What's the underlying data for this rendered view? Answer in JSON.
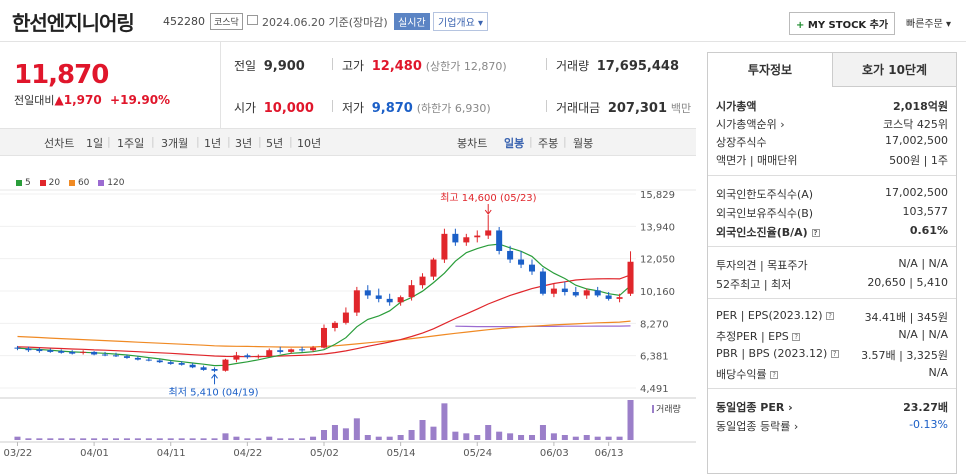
{
  "header": {
    "stock_name": "한선엔지니어링",
    "code": "452280",
    "market": "코스닥",
    "date_text": "2024.06.20 기준(장마감)",
    "realtime_badge": "실시간",
    "corp_overview": "기업개요 ▾",
    "mystock_plus": "+",
    "mystock_label": "MY STOCK 추가",
    "fast_order": "빠른주문 ▾"
  },
  "price": {
    "current": "11,870",
    "change_label": "전일대비",
    "change_arrow": "▲",
    "change_amount": "1,970",
    "change_pct": "+19.90%",
    "prev_close_label": "전일",
    "prev_close": "9,900",
    "high_label": "고가",
    "high": "12,480",
    "upper_limit": "(상한가 12,870)",
    "volume_label": "거래량",
    "volume": "17,695,448",
    "open_label": "시가",
    "open": "10,000",
    "low_label": "저가",
    "low": "9,870",
    "lower_limit": "(하한가 6,930)",
    "value_label": "거래대금",
    "value": "207,301",
    "value_unit": "백만"
  },
  "tabs": {
    "line_chart": "선차트",
    "line_items": [
      "1일",
      "1주일",
      "3개월",
      "1년",
      "3년",
      "5년",
      "10년"
    ],
    "candle_chart": "봉차트",
    "candle_items": [
      "일봉",
      "주봉",
      "월봉"
    ],
    "active_candle": "일봉"
  },
  "chart_data": {
    "type": "candlestick",
    "legend": [
      {
        "name": "5",
        "color": "#2a9d3a"
      },
      {
        "name": "20",
        "color": "#e0262b"
      },
      {
        "name": "60",
        "color": "#f08a24"
      },
      {
        "name": "120",
        "color": "#9b6bd1"
      }
    ],
    "y_ticks": [
      "15,829",
      "13,940",
      "12,050",
      "10,160",
      "8,270",
      "6,381",
      "4,491"
    ],
    "y_range": [
      4491,
      15829
    ],
    "x_ticks": [
      "03/22",
      "04/01",
      "04/11",
      "04/22",
      "05/02",
      "05/14",
      "05/24",
      "06/03",
      "06/13"
    ],
    "max_annotation": "최고 14,600 (05/23)",
    "min_annotation": "최저 5,410 (04/19)",
    "volume_label": "거래량",
    "candles": [
      {
        "o": 6850,
        "h": 6950,
        "l": 6700,
        "c": 6800
      },
      {
        "o": 6800,
        "h": 6900,
        "l": 6600,
        "c": 6700
      },
      {
        "o": 6750,
        "h": 6850,
        "l": 6550,
        "c": 6650
      },
      {
        "o": 6700,
        "h": 6800,
        "l": 6550,
        "c": 6600
      },
      {
        "o": 6650,
        "h": 6750,
        "l": 6500,
        "c": 6550
      },
      {
        "o": 6600,
        "h": 6700,
        "l": 6450,
        "c": 6500
      },
      {
        "o": 6550,
        "h": 6700,
        "l": 6450,
        "c": 6600
      },
      {
        "o": 6600,
        "h": 6650,
        "l": 6400,
        "c": 6450
      },
      {
        "o": 6450,
        "h": 6600,
        "l": 6350,
        "c": 6400
      },
      {
        "o": 6400,
        "h": 6550,
        "l": 6300,
        "c": 6350
      },
      {
        "o": 6350,
        "h": 6450,
        "l": 6200,
        "c": 6250
      },
      {
        "o": 6250,
        "h": 6350,
        "l": 6100,
        "c": 6150
      },
      {
        "o": 6150,
        "h": 6250,
        "l": 6050,
        "c": 6100
      },
      {
        "o": 6100,
        "h": 6200,
        "l": 5950,
        "c": 6000
      },
      {
        "o": 6000,
        "h": 6100,
        "l": 5850,
        "c": 5900
      },
      {
        "o": 5950,
        "h": 6050,
        "l": 5800,
        "c": 5850
      },
      {
        "o": 5850,
        "h": 5950,
        "l": 5650,
        "c": 5700
      },
      {
        "o": 5700,
        "h": 5800,
        "l": 5500,
        "c": 5550
      },
      {
        "o": 5600,
        "h": 5700,
        "l": 5410,
        "c": 5500
      },
      {
        "o": 5500,
        "h": 6200,
        "l": 5450,
        "c": 6150
      },
      {
        "o": 6150,
        "h": 6600,
        "l": 6000,
        "c": 6400
      },
      {
        "o": 6400,
        "h": 6500,
        "l": 6200,
        "c": 6300
      },
      {
        "o": 6300,
        "h": 6450,
        "l": 6200,
        "c": 6350
      },
      {
        "o": 6350,
        "h": 6800,
        "l": 6300,
        "c": 6700
      },
      {
        "o": 6700,
        "h": 6900,
        "l": 6500,
        "c": 6600
      },
      {
        "o": 6600,
        "h": 6800,
        "l": 6500,
        "c": 6750
      },
      {
        "o": 6750,
        "h": 6900,
        "l": 6600,
        "c": 6700
      },
      {
        "o": 6700,
        "h": 6950,
        "l": 6600,
        "c": 6850
      },
      {
        "o": 6850,
        "h": 8200,
        "l": 6800,
        "c": 8000
      },
      {
        "o": 8000,
        "h": 8400,
        "l": 7800,
        "c": 8300
      },
      {
        "o": 8300,
        "h": 9200,
        "l": 8200,
        "c": 8900
      },
      {
        "o": 8900,
        "h": 10400,
        "l": 8700,
        "c": 10200
      },
      {
        "o": 10200,
        "h": 10500,
        "l": 9700,
        "c": 9900
      },
      {
        "o": 9900,
        "h": 10300,
        "l": 9500,
        "c": 9700
      },
      {
        "o": 9700,
        "h": 10000,
        "l": 9300,
        "c": 9500
      },
      {
        "o": 9500,
        "h": 9900,
        "l": 9300,
        "c": 9800
      },
      {
        "o": 9800,
        "h": 10800,
        "l": 9600,
        "c": 10500
      },
      {
        "o": 10500,
        "h": 11200,
        "l": 10300,
        "c": 11000
      },
      {
        "o": 11000,
        "h": 12100,
        "l": 10800,
        "c": 12000
      },
      {
        "o": 12000,
        "h": 13800,
        "l": 11800,
        "c": 13500
      },
      {
        "o": 13500,
        "h": 13800,
        "l": 12800,
        "c": 13000
      },
      {
        "o": 13000,
        "h": 13500,
        "l": 12800,
        "c": 13300
      },
      {
        "o": 13300,
        "h": 13700,
        "l": 13000,
        "c": 13400
      },
      {
        "o": 13400,
        "h": 14600,
        "l": 13200,
        "c": 13700
      },
      {
        "o": 13700,
        "h": 13900,
        "l": 12300,
        "c": 12500
      },
      {
        "o": 12500,
        "h": 12800,
        "l": 11800,
        "c": 12000
      },
      {
        "o": 12000,
        "h": 12500,
        "l": 11500,
        "c": 11700
      },
      {
        "o": 11700,
        "h": 12000,
        "l": 11100,
        "c": 11300
      },
      {
        "o": 11300,
        "h": 11500,
        "l": 9900,
        "c": 10000
      },
      {
        "o": 10000,
        "h": 10600,
        "l": 9800,
        "c": 10300
      },
      {
        "o": 10300,
        "h": 10700,
        "l": 9900,
        "c": 10100
      },
      {
        "o": 10100,
        "h": 10400,
        "l": 9800,
        "c": 9900
      },
      {
        "o": 9900,
        "h": 10300,
        "l": 9700,
        "c": 10200
      },
      {
        "o": 10200,
        "h": 10400,
        "l": 9800,
        "c": 9900
      },
      {
        "o": 9900,
        "h": 10100,
        "l": 9600,
        "c": 9700
      },
      {
        "o": 9700,
        "h": 10000,
        "l": 9500,
        "c": 9800
      },
      {
        "o": 10000,
        "h": 12480,
        "l": 9870,
        "c": 11870
      }
    ],
    "ma5": [
      6820,
      6780,
      6740,
      6700,
      6650,
      6600,
      6580,
      6550,
      6520,
      6470,
      6420,
      6350,
      6270,
      6190,
      6100,
      6030,
      5950,
      5880,
      5800,
      5820,
      5920,
      6020,
      6140,
      6280,
      6410,
      6520,
      6560,
      6610,
      6730,
      7040,
      7430,
      8070,
      8500,
      8700,
      9000,
      9500,
      9780,
      10150,
      10650,
      11200,
      11900,
      12400,
      12640,
      12830,
      12900,
      12680,
      12480,
      12180,
      11600,
      11200,
      10890,
      10500,
      10280,
      10170,
      10000,
      9900,
      10470
    ],
    "ma20": [
      6900,
      6880,
      6850,
      6820,
      6800,
      6770,
      6750,
      6720,
      6700,
      6670,
      6640,
      6610,
      6580,
      6550,
      6520,
      6480,
      6440,
      6400,
      6360,
      6340,
      6330,
      6320,
      6330,
      6340,
      6360,
      6380,
      6400,
      6430,
      6480,
      6560,
      6660,
      6790,
      6930,
      7050,
      7180,
      7320,
      7500,
      7700,
      7950,
      8250,
      8550,
      8820,
      9100,
      9400,
      9650,
      9900,
      10100,
      10300,
      10450,
      10600,
      10700,
      10800,
      10850,
      10870,
      10880,
      10870,
      11100
    ],
    "ma60": [
      7500,
      7470,
      7440,
      7410,
      7380,
      7350,
      7320,
      7290,
      7260,
      7230,
      7200,
      7170,
      7140,
      7110,
      7080,
      7050,
      7020,
      6990,
      6960,
      6940,
      6930,
      6920,
      6910,
      6900,
      6890,
      6880,
      6880,
      6890,
      6920,
      6960,
      7010,
      7070,
      7130,
      7190,
      7250,
      7310,
      7380,
      7450,
      7530,
      7610,
      7690,
      7760,
      7830,
      7900,
      7960,
      8010,
      8060,
      8100,
      8140,
      8180,
      8210,
      8240,
      8270,
      8300,
      8320,
      8340,
      8400
    ],
    "ma120": [
      null,
      null,
      null,
      null,
      null,
      null,
      null,
      null,
      null,
      null,
      null,
      null,
      null,
      null,
      null,
      null,
      null,
      null,
      null,
      null,
      null,
      null,
      null,
      null,
      null,
      null,
      null,
      null,
      null,
      null,
      null,
      null,
      null,
      null,
      null,
      null,
      null,
      null,
      null,
      null,
      8100,
      8090,
      8080,
      8080,
      8080,
      8080,
      8080,
      8090,
      8090,
      8090,
      8100,
      8100,
      8100,
      8110,
      8110,
      8110,
      8120
    ],
    "volume": [
      2,
      1,
      1,
      1,
      1,
      1,
      1,
      1,
      1,
      1,
      1,
      1,
      1,
      1,
      1,
      1,
      1,
      1,
      1,
      4,
      2,
      1,
      1,
      2,
      1,
      1,
      1,
      2,
      6,
      9,
      7,
      13,
      3,
      2,
      2,
      3,
      6,
      12,
      8,
      22,
      5,
      4,
      3,
      9,
      5,
      4,
      3,
      3,
      9,
      4,
      3,
      2,
      3,
      2,
      2,
      2,
      24
    ]
  },
  "side": {
    "tab_invest": "투자정보",
    "tab_hoga": "호가 10단계",
    "market_cap_label": "시가총액",
    "market_cap": "2,018억원",
    "market_cap_rank_label": "시가총액순위 ›",
    "market_cap_rank": "코스닥 425위",
    "shares_label": "상장주식수",
    "shares": "17,002,500",
    "face_label": "액면가 | 매매단위",
    "face": "500원 | 1주",
    "foreign_limit_label": "외국인한도주식수(A)",
    "foreign_limit": "17,002,500",
    "foreign_hold_label": "외국인보유주식수(B)",
    "foreign_hold": "103,577",
    "foreign_ratio_label": "외국인소진율(B/A)",
    "foreign_ratio": "0.61%",
    "opinion_label": "투자의견 | 목표주가",
    "opinion": "N/A | N/A",
    "week52_label": "52주최고 | 최저",
    "week52": "20,650 | 5,410",
    "per_label": "PER | EPS(2023.12)",
    "per": "34.41배 | 345원",
    "est_per_label": "추정PER | EPS",
    "est_per": "N/A | N/A",
    "pbr_label": "PBR | BPS (2023.12)",
    "pbr": "3.57배 | 3,325원",
    "dividend_label": "배당수익률",
    "dividend": "N/A",
    "sector_per_label": "동일업종 PER ›",
    "sector_per": "23.27배",
    "sector_rate_label": "동일업종 등락률 ›",
    "sector_rate": "-0.13%"
  }
}
